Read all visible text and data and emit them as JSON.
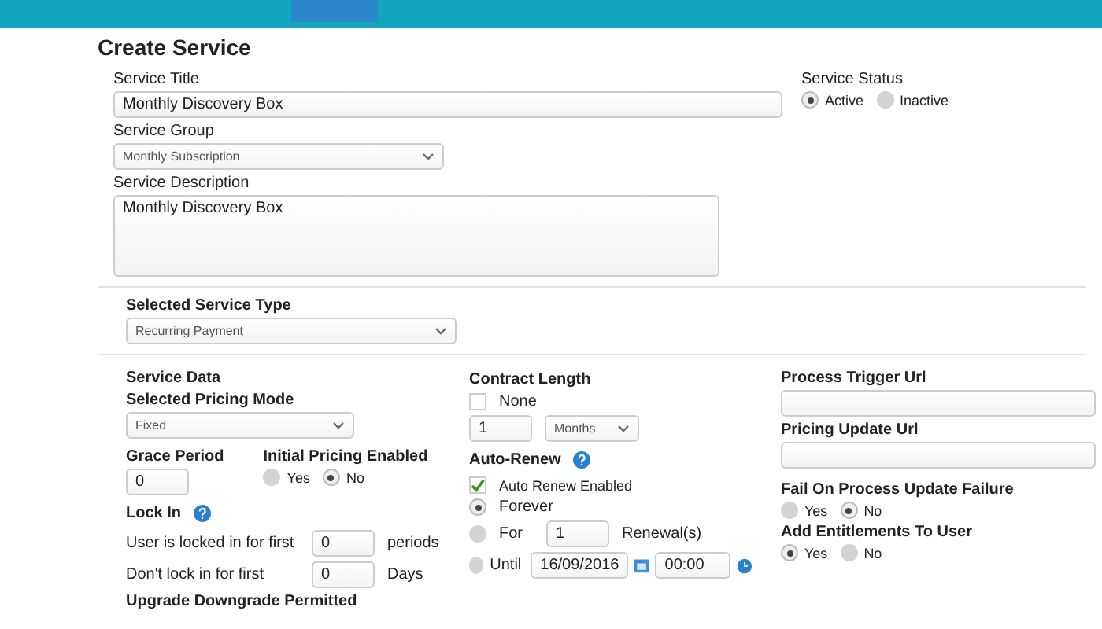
{
  "page_title": "Create Service",
  "service_title": {
    "label": "Service Title",
    "value": "Monthly Discovery Box"
  },
  "service_group": {
    "label": "Service Group",
    "value": "Monthly Subscription"
  },
  "service_description": {
    "label": "Service Description",
    "value": "Monthly Discovery Box"
  },
  "service_status": {
    "label": "Service Status",
    "options": [
      {
        "label": "Active",
        "selected": true
      },
      {
        "label": "Inactive",
        "selected": false
      }
    ]
  },
  "service_type": {
    "label": "Selected Service Type",
    "value": "Recurring Payment"
  },
  "service_data": {
    "heading": "Service Data",
    "pricing_mode": {
      "label": "Selected Pricing Mode",
      "value": "Fixed"
    },
    "grace_period": {
      "label": "Grace Period",
      "value": "0"
    },
    "initial_pricing": {
      "label": "Initial Pricing Enabled",
      "options": [
        {
          "label": "Yes",
          "selected": false
        },
        {
          "label": "No",
          "selected": true
        }
      ]
    },
    "lock_in": {
      "label": "Lock In",
      "locked_label": "User is locked in for first",
      "locked_value": "0",
      "locked_unit": "periods",
      "unlocked_label": "Don't lock in for first",
      "unlocked_value": "0",
      "unlocked_unit": "Days"
    },
    "upgrade_label": "Upgrade Downgrade Permitted"
  },
  "contract": {
    "label": "Contract Length",
    "none": {
      "label": "None",
      "checked": false
    },
    "value": "1",
    "unit": "Months"
  },
  "auto_renew": {
    "label": "Auto-Renew",
    "enabled": {
      "label": "Auto Renew Enabled",
      "checked": true
    },
    "options": [
      {
        "kind": "forever",
        "label": "Forever",
        "selected": true
      },
      {
        "kind": "count",
        "label": "For",
        "value": "1",
        "unit": "Renewal(s)",
        "selected": false
      },
      {
        "kind": "date",
        "label": "Until",
        "date": "16/09/2016",
        "time": "00:00",
        "selected": false
      }
    ]
  },
  "process_trigger_url": {
    "label": "Process Trigger Url"
  },
  "pricing_update_url": {
    "label": "Pricing Update Url"
  },
  "fail_on_failure": {
    "label": "Fail On Process Update Failure",
    "options": [
      {
        "label": "Yes",
        "selected": false
      },
      {
        "label": "No",
        "selected": true
      }
    ]
  },
  "add_entitlements": {
    "label": "Add Entitlements To User",
    "options": [
      {
        "label": "Yes",
        "selected": true
      },
      {
        "label": "No",
        "selected": false
      }
    ]
  }
}
